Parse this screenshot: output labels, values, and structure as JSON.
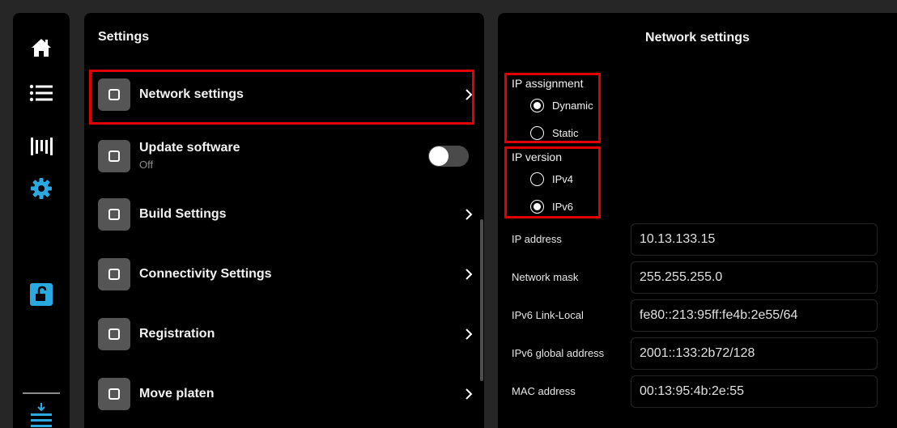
{
  "rail": {
    "items": [
      {
        "icon": "home-icon"
      },
      {
        "icon": "list-icon"
      },
      {
        "icon": "jobs-icon"
      },
      {
        "icon": "gear-icon"
      },
      {
        "icon": "unlock-icon"
      },
      {
        "icon": "download-icon"
      }
    ]
  },
  "settings": {
    "title": "Settings",
    "items": [
      {
        "label": "Network settings",
        "type": "link"
      },
      {
        "label": "Update software",
        "sub": "Off",
        "type": "toggle",
        "on": false
      },
      {
        "label": "Build Settings",
        "type": "link"
      },
      {
        "label": "Connectivity Settings",
        "type": "link"
      },
      {
        "label": "Registration",
        "type": "link"
      },
      {
        "label": "Move platen",
        "type": "link"
      }
    ]
  },
  "network": {
    "title": "Network settings",
    "ip_assignment": {
      "label": "IP assignment",
      "options": [
        "Dynamic",
        "Static"
      ],
      "selected": "Dynamic"
    },
    "ip_version": {
      "label": "IP version",
      "options": [
        "IPv4",
        "IPv6"
      ],
      "selected": "IPv6"
    },
    "fields": [
      {
        "label": "IP address",
        "value": "10.13.133.15"
      },
      {
        "label": "Network mask",
        "value": "255.255.255.0"
      },
      {
        "label": "IPv6 Link-Local",
        "value": "fe80::213:95ff:fe4b:2e55/64"
      },
      {
        "label": "IPv6 global address",
        "value": "2001::133:2b72/128"
      },
      {
        "label": "MAC address",
        "value": "00:13:95:4b:2e:55"
      }
    ]
  },
  "colors": {
    "highlight": "#e00000",
    "accent": "#2aa8e0",
    "background": "#262626",
    "panel": "#000000"
  }
}
